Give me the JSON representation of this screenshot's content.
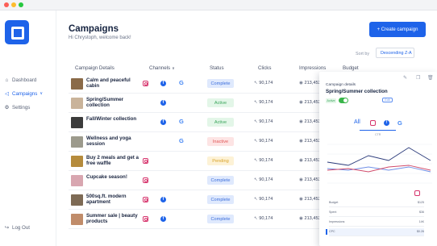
{
  "sidebar": {
    "items": [
      {
        "label": "Dashboard",
        "icon": "home-icon"
      },
      {
        "label": "Campaigns",
        "icon": "megaphone-icon"
      },
      {
        "label": "Settings",
        "icon": "gear-icon"
      }
    ],
    "logout": "Log Out"
  },
  "header": {
    "title": "Campaigns",
    "subtitle": "Hi Chrystoph, welcome back!",
    "create_button": "+ Create campaign",
    "sort_label": "Sort by",
    "sort_value": "Descending Z-A"
  },
  "table": {
    "columns": [
      "Campaign Details",
      "Channels",
      "Status",
      "Clicks",
      "Impressions",
      "Budget"
    ],
    "rows": [
      {
        "name": "Calm and peaceful cabin",
        "channels": [
          "instagram",
          "facebook",
          "google"
        ],
        "status": "Complete",
        "clicks": "90,174",
        "impressions": "213,453",
        "thumb": "#8a6a48"
      },
      {
        "name": "Spring/Summer collection",
        "channels": [
          "facebook"
        ],
        "status": "Active",
        "clicks": "90,174",
        "impressions": "213,453",
        "thumb": "#c9b39a"
      },
      {
        "name": "Fall/Winter collection",
        "channels": [
          "facebook",
          "google"
        ],
        "status": "Active",
        "clicks": "90,174",
        "impressions": "213,453",
        "thumb": "#3b3b3b"
      },
      {
        "name": "Wellness and yoga session",
        "channels": [
          "google"
        ],
        "status": "Inactive",
        "clicks": "90,174",
        "impressions": "213,453",
        "thumb": "#9c9a8c"
      },
      {
        "name": "Buy 2 meals and get a free waffle",
        "channels": [
          "instagram"
        ],
        "status": "Pending",
        "clicks": "90,174",
        "impressions": "213,453",
        "thumb": "#b58b3c"
      },
      {
        "name": "Cupcake season!",
        "channels": [
          "instagram"
        ],
        "status": "Complete",
        "clicks": "90,174",
        "impressions": "213,453",
        "thumb": "#d8a6b0"
      },
      {
        "name": "500sq.ft. modern apartment",
        "channels": [
          "instagram",
          "facebook"
        ],
        "status": "Complete",
        "clicks": "90,174",
        "impressions": "213,453",
        "thumb": "#7d6a55"
      },
      {
        "name": "Summer sale | beauty products",
        "channels": [
          "instagram",
          "facebook"
        ],
        "status": "Complete",
        "clicks": "90,174",
        "impressions": "213,453",
        "thumb": "#c08c6a"
      }
    ]
  },
  "panel": {
    "label": "Campaign details",
    "title": "Spring/Summer collection",
    "status": "Active",
    "edit": "Edit",
    "tab_all": "All",
    "chart_caption": "CTR",
    "stats": [
      {
        "label": "Budget",
        "value": "$125"
      },
      {
        "label": "Spent",
        "value": "$36"
      },
      {
        "label": "Impressions",
        "value": "14K"
      },
      {
        "label": "CPC",
        "value": "$0.26"
      }
    ]
  },
  "colors": {
    "accent": "#1e63e9",
    "complete": "#3d6fdc",
    "active": "#3aa55b",
    "inactive": "#e25656",
    "pending": "#d9a32a"
  }
}
